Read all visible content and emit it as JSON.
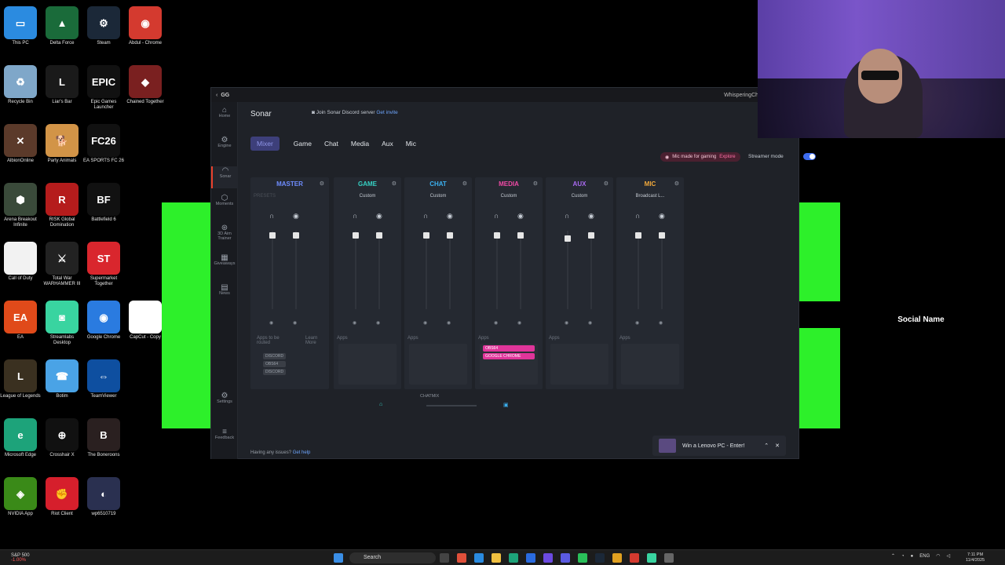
{
  "desktop_icons": [
    {
      "label": "This PC",
      "color": "#2b8be0",
      "glyph": "▭"
    },
    {
      "label": "Delta Force",
      "color": "#1a6b3a",
      "glyph": "▲"
    },
    {
      "label": "Steam",
      "color": "#1b2838",
      "glyph": "⚙"
    },
    {
      "label": "Abdul - Chrome",
      "color": "#d43a2f",
      "glyph": "◉"
    },
    {
      "label": "Recycle Bin",
      "color": "#7fa7c9",
      "glyph": "♻"
    },
    {
      "label": "Liar's Bar",
      "color": "#1a1a1a",
      "glyph": "L"
    },
    {
      "label": "Epic Games Launcher",
      "color": "#111",
      "glyph": "EPIC"
    },
    {
      "label": "Chained Together",
      "color": "#7a2020",
      "glyph": "◆"
    },
    {
      "label": "AlbionOnline",
      "color": "#5b3a2a",
      "glyph": "✕"
    },
    {
      "label": "Party Animals",
      "color": "#d29447",
      "glyph": "🐕"
    },
    {
      "label": "EA SPORTS FC 26",
      "color": "#111",
      "glyph": "FC26"
    },
    {
      "label": "Arena Breakout Infinite",
      "color": "#3a4a3a",
      "glyph": "⬢"
    },
    {
      "label": "RISK Global Domination",
      "color": "#b51c1c",
      "glyph": "R"
    },
    {
      "label": "Battlefield 6",
      "color": "#111",
      "glyph": "BF"
    },
    {
      "label": "Call of Duty",
      "color": "#f2f2f2",
      "glyph": ""
    },
    {
      "label": "Total War WARHAMMER III",
      "color": "#222",
      "glyph": "⚔"
    },
    {
      "label": "Supermarket Together",
      "color": "#d9262d",
      "glyph": "ST"
    },
    {
      "label": "EA",
      "color": "#e04a1a",
      "glyph": "EA"
    },
    {
      "label": "Streamlabs Desktop",
      "color": "#39d4a0",
      "glyph": "◙"
    },
    {
      "label": "Google Chrome",
      "color": "#2a7be0",
      "glyph": "◉"
    },
    {
      "label": "CapCut - Copy",
      "color": "#fff",
      "glyph": "✂"
    },
    {
      "label": "League of Legends",
      "color": "#3a3020",
      "glyph": "L"
    },
    {
      "label": "Botim",
      "color": "#4aa3e6",
      "glyph": "☎"
    },
    {
      "label": "TeamViewer",
      "color": "#0e4fa0",
      "glyph": "⇔"
    },
    {
      "label": "Microsoft Edge",
      "color": "#1da37a",
      "glyph": "e"
    },
    {
      "label": "Crosshair X",
      "color": "#111",
      "glyph": "⊕"
    },
    {
      "label": "The Boneroons",
      "color": "#2a2020",
      "glyph": "B"
    },
    {
      "label": "NVIDIA App",
      "color": "#3a8a18",
      "glyph": "◈"
    },
    {
      "label": "Riot Client",
      "color": "#d61f2c",
      "glyph": "✊"
    },
    {
      "label": "wp6510719",
      "color": "#2a3050",
      "glyph": "◐"
    }
  ],
  "overlay": {
    "social_name": "Social Name"
  },
  "app": {
    "title": "GG",
    "username": "WhisperingCheese47",
    "nav": [
      {
        "label": "Home",
        "icon": "home-icon",
        "glyph": "⌂"
      },
      {
        "label": "Engine",
        "icon": "engine-icon",
        "glyph": "⚙"
      },
      {
        "label": "Sonar",
        "icon": "sonar-icon",
        "glyph": "◠"
      },
      {
        "label": "Moments",
        "icon": "moments-icon",
        "glyph": "⬡"
      },
      {
        "label": "3D Aim Trainer",
        "icon": "aim-icon",
        "glyph": "⊛"
      },
      {
        "label": "Giveaways",
        "icon": "gift-icon",
        "glyph": "▦"
      },
      {
        "label": "News",
        "icon": "news-icon",
        "glyph": "▤"
      },
      {
        "label": "Settings",
        "icon": "settings-icon",
        "glyph": "⚙"
      },
      {
        "label": "Feedback",
        "icon": "feedback-icon",
        "glyph": "≡"
      }
    ],
    "header": "Sonar",
    "discord_text": "Join Sonar Discord server",
    "discord_link": "Get invite",
    "tabs": [
      "Mixer",
      "Game",
      "Chat",
      "Media",
      "Aux",
      "Mic"
    ],
    "mic_promo": "Mic made for gaming",
    "mic_promo_link": "Explore",
    "streamer_mode": "Streamer mode",
    "channels": [
      {
        "name": "MASTER",
        "color": "#6f8dff",
        "preset": "PRESETS",
        "hp": 0.02,
        "bc": 0.02
      },
      {
        "name": "GAME",
        "color": "#36d1c4",
        "preset": "Custom",
        "hp": 0.02,
        "bc": 0.02
      },
      {
        "name": "CHAT",
        "color": "#3bb0f0",
        "preset": "Custom",
        "hp": 0.02,
        "bc": 0.02
      },
      {
        "name": "MEDIA",
        "color": "#f04aa6",
        "preset": "Custom",
        "hp": 0.02,
        "bc": 0.02
      },
      {
        "name": "AUX",
        "color": "#a96af0",
        "preset": "Custom",
        "hp": 0.06,
        "bc": 0.02
      },
      {
        "name": "MIC",
        "color": "#f0a83b",
        "preset": "Broadcast L...",
        "hp": 0.02,
        "bc": 0.02
      }
    ],
    "apps_label": "Apps",
    "master_apps_text": "Apps to be routed",
    "master_learn": "Learn More",
    "master_apps": [
      "DISCORD",
      "OBS64",
      "DISCORD"
    ],
    "media_apps": [
      "OBS64",
      "GOOGLE CHROME"
    ],
    "chatmix_label": "CHATMIX",
    "issues_text": "Having any issues?",
    "issues_link": "Get help"
  },
  "toast": {
    "text": "Win a Lenovo PC - Enter!"
  },
  "taskbar": {
    "stock_name": "S&P 500",
    "stock_change": "-1.00%",
    "search_placeholder": "Search",
    "lang": "ENG",
    "time": "7:11 PM",
    "date": "11/4/2025"
  }
}
